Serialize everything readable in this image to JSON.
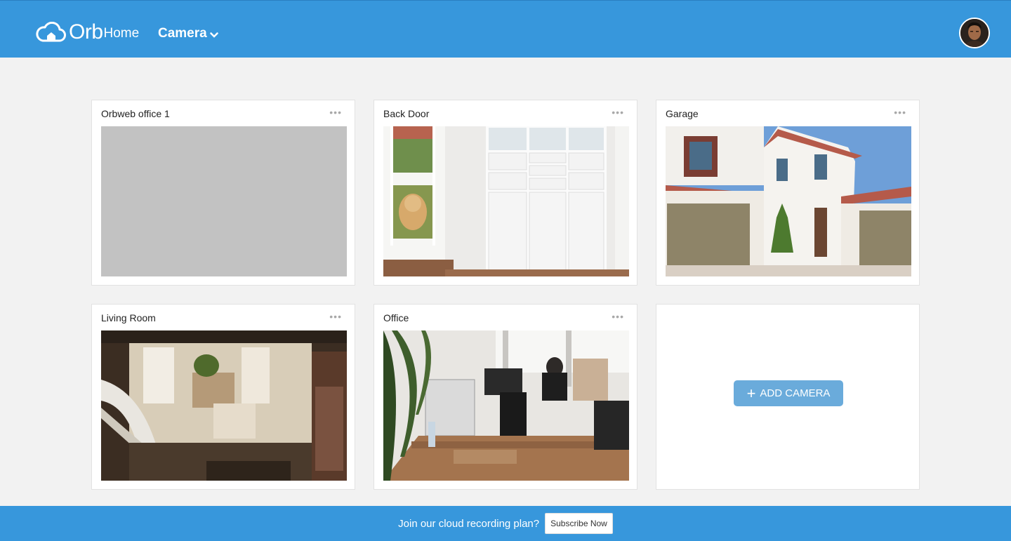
{
  "header": {
    "logo_main": "Orb",
    "logo_sub": "Home",
    "nav_label": "Camera",
    "icons": {
      "logo": "cloud-home-icon",
      "nav": "chevron-down-icon",
      "avatar": "user-avatar"
    }
  },
  "cameras": [
    {
      "title": "Orbweb office 1",
      "menu": "•••",
      "feed": "blank"
    },
    {
      "title": "Back Door",
      "menu": "•••",
      "feed": "white-cabinets-door-with-dog"
    },
    {
      "title": "Garage",
      "menu": "•••",
      "feed": "white-house-with-garages"
    },
    {
      "title": "Living Room",
      "menu": "•••",
      "feed": "living-room-with-staircase"
    },
    {
      "title": "Office",
      "menu": "•••",
      "feed": "open-office-with-desks"
    }
  ],
  "add_camera": {
    "label": "ADD CAMERA",
    "icon": "plus-icon"
  },
  "footer": {
    "message": "Join our cloud recording plan?",
    "button_label": "Subscribe Now"
  },
  "colors": {
    "brand_blue": "#3797dc",
    "add_button": "#6aabdb",
    "page_bg": "#f2f2f2",
    "placeholder_gray": "#c2c2c2"
  }
}
